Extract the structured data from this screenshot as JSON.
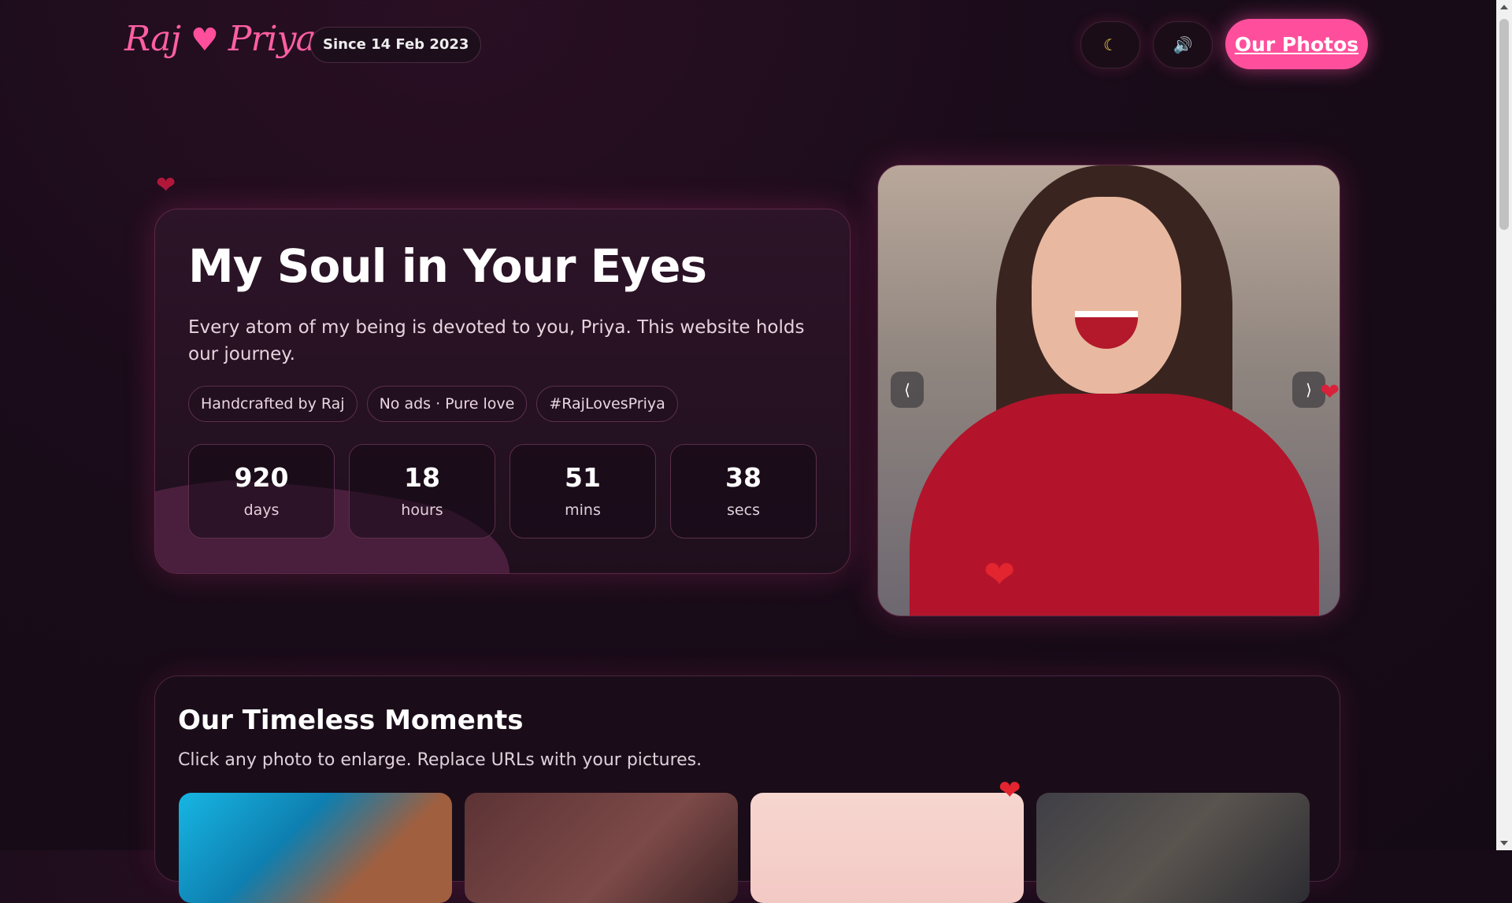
{
  "header": {
    "logo_left": "Raj",
    "logo_heart": "♥",
    "logo_right": "Priya",
    "since": "Since 14 Feb 2023",
    "theme_icon": "☾",
    "sound_icon": "🔊",
    "photos_button": "Our Photos"
  },
  "hero": {
    "title": "My Soul in Your Eyes",
    "subtitle": "Every atom of my being is devoted to you, Priya. This website holds our journey.",
    "tags": [
      "Handcrafted by Raj",
      "No ads · Pure love",
      "#RajLovesPriya"
    ],
    "counters": [
      {
        "value": "920",
        "unit": "days"
      },
      {
        "value": "18",
        "unit": "hours"
      },
      {
        "value": "51",
        "unit": "mins"
      },
      {
        "value": "38",
        "unit": "secs"
      }
    ]
  },
  "carousel": {
    "prev": "⟨",
    "next": "⟩"
  },
  "moments": {
    "title": "Our Timeless Moments",
    "subtitle": "Click any photo to enlarge. Replace URLs with your pictures."
  },
  "colors": {
    "accent": "#ff4f9c",
    "background": "#140a15",
    "card": "#1f0f1d"
  },
  "icons": [
    "heart-icon",
    "moon-icon",
    "speaker-icon",
    "chevron-left-icon",
    "chevron-right-icon"
  ]
}
